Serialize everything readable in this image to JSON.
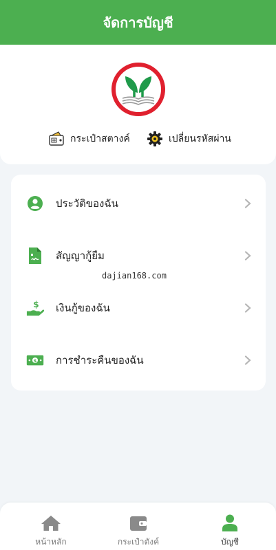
{
  "header": {
    "title": "จัดการบัญชี"
  },
  "profile": {
    "logo_icon": "kbank-logo",
    "actions": [
      {
        "label": "กระเป๋าสตางค์",
        "icon": "wallet-icon"
      },
      {
        "label": "เปลี่ยนรหัสผ่าน",
        "icon": "gear-icon"
      }
    ]
  },
  "menu": {
    "items": [
      {
        "label": "ประวัติของฉัน",
        "icon": "user-circle-icon"
      },
      {
        "label": "สัญญากู้ยืม",
        "icon": "contract-file-icon"
      },
      {
        "label": "เงินกู้ของฉัน",
        "icon": "hand-money-icon"
      },
      {
        "label": "การชำระคืนของฉัน",
        "icon": "banknote-icon"
      }
    ]
  },
  "watermark": "dajian168.com",
  "bottom_nav": {
    "items": [
      {
        "label": "หน้าหลัก",
        "icon": "home-icon",
        "active": false
      },
      {
        "label": "กระเป๋าตังค์",
        "icon": "wallet-icon",
        "active": false
      },
      {
        "label": "บัญชี",
        "icon": "user-icon",
        "active": true
      }
    ]
  },
  "colors": {
    "brand_green": "#4caf50",
    "logo_red": "#e0202e",
    "logo_green": "#1f9a4a",
    "nav_icon_gray": "#8a8a8a",
    "chevron_gray": "#b5b5b5"
  }
}
